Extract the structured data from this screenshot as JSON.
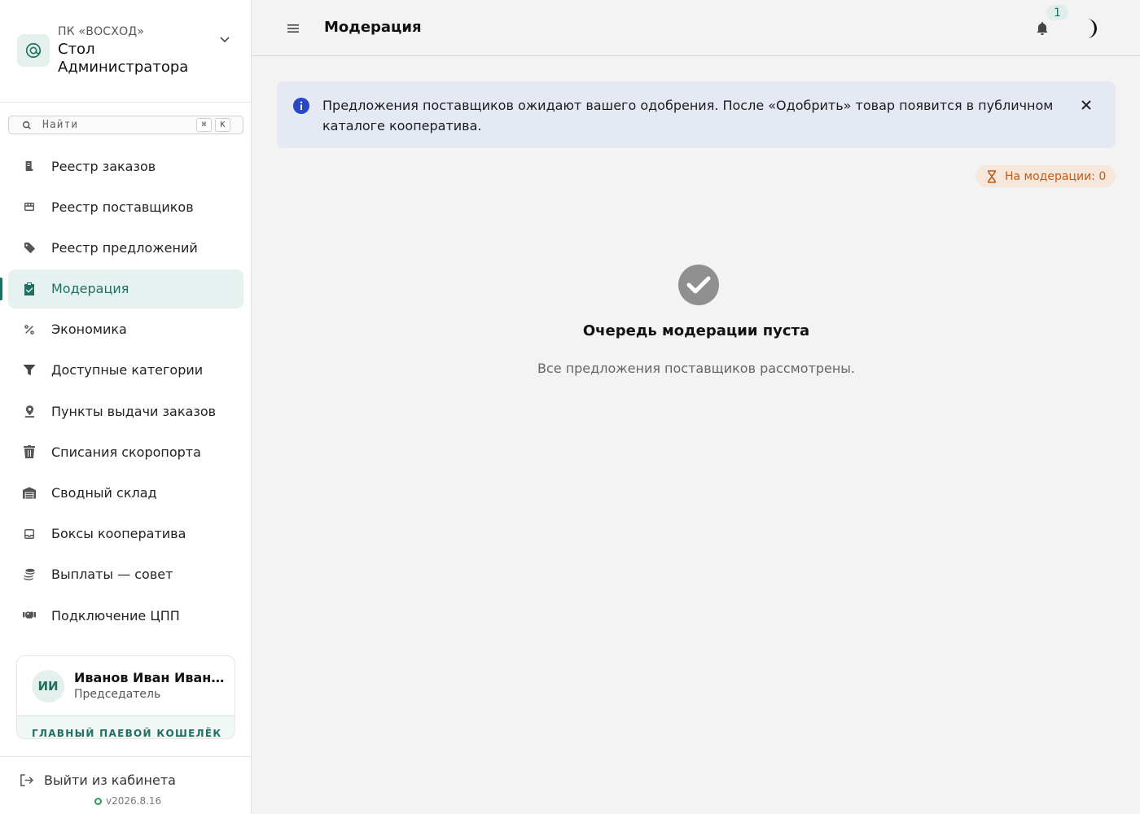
{
  "brand": {
    "org": "ПК «ВОСХОД»",
    "title": "Стол Администратора"
  },
  "search": {
    "placeholder": "Найти",
    "shortcut_mod": "⌘",
    "shortcut_key": "K"
  },
  "nav": {
    "items": [
      {
        "label": "Реестр заказов",
        "icon": "receipt-icon"
      },
      {
        "label": "Реестр поставщиков",
        "icon": "store-icon"
      },
      {
        "label": "Реестр предложений",
        "icon": "tag-icon"
      },
      {
        "label": "Модерация",
        "icon": "clipboard-check-icon",
        "active": true
      },
      {
        "label": "Экономика",
        "icon": "percent-icon"
      },
      {
        "label": "Доступные категории",
        "icon": "filter-icon"
      },
      {
        "label": "Пункты выдачи заказов",
        "icon": "map-pin-icon"
      },
      {
        "label": "Списания скоропорта",
        "icon": "trash-icon"
      },
      {
        "label": "Сводный склад",
        "icon": "warehouse-icon"
      },
      {
        "label": "Боксы кооператива",
        "icon": "inbox-icon"
      },
      {
        "label": "Выплаты — совет",
        "icon": "coins-icon"
      },
      {
        "label": "Подключение ЦПП",
        "icon": "handshake-icon"
      }
    ]
  },
  "user": {
    "initials": "ИИ",
    "name": "Иванов Иван Иванович",
    "role": "Председатель",
    "wallet_label": "ГЛАВНЫЙ ПАЕВОЙ КОШЕЛЁК"
  },
  "footer": {
    "logout_label": "Выйти из кабинета",
    "version": "v2026.8.16"
  },
  "header": {
    "title": "Модерация",
    "notifications_count": "1"
  },
  "alert": {
    "text": "Предложения поставщиков ожидают вашего одобрения. После «Одобрить» товар появится в публичном каталоге кооператива."
  },
  "status_chip": {
    "label": "На модерации: 0"
  },
  "empty_state": {
    "title": "Очередь модерации пуста",
    "subtitle": "Все предложения поставщиков рассмотрены."
  },
  "colors": {
    "accent": "#1f6f62",
    "info": "#2747c6",
    "warning": "#c45a14"
  }
}
